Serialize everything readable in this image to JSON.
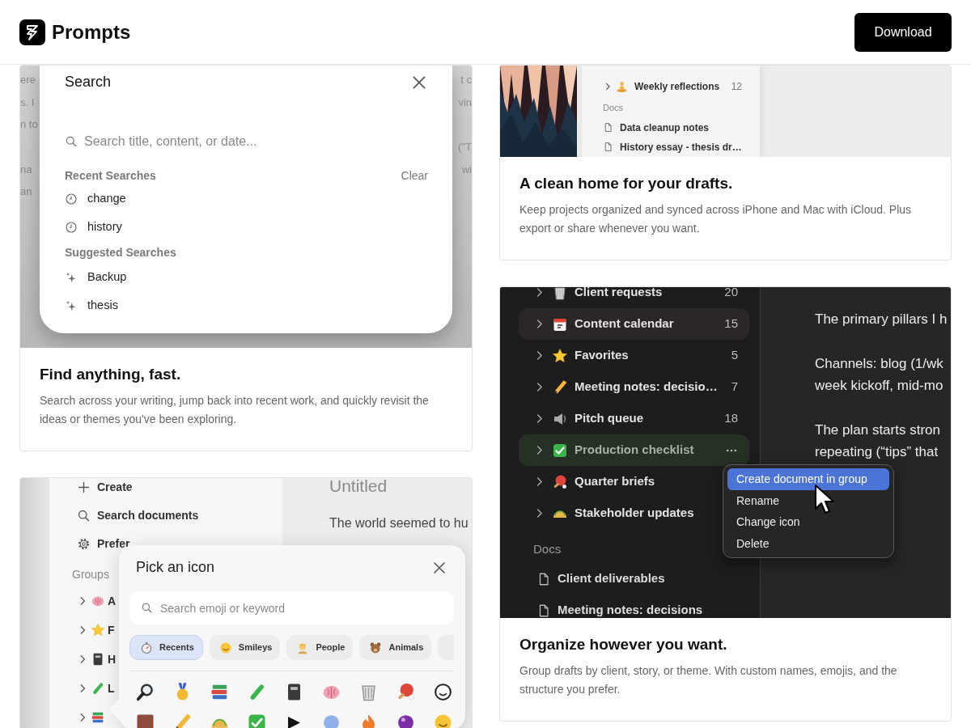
{
  "header": {
    "brand": "Prompts",
    "download_button": "Download"
  },
  "search_card": {
    "screenshot": {
      "backdrop_left": [
        [
          "ere",
          "s. I",
          "n to"
        ],
        [
          "na",
          "an"
        ]
      ],
      "backdrop_right": [
        [
          "t c",
          "vin"
        ],
        [
          "(\"T",
          "wi"
        ]
      ],
      "dialog": {
        "title": "Search",
        "placeholder": "Search title, content, or date...",
        "recent_heading": "Recent Searches",
        "clear_button": "Clear",
        "recent": [
          "change",
          "history"
        ],
        "suggested_heading": "Suggested Searches",
        "suggested": [
          "Backup",
          "thesis"
        ]
      }
    },
    "title": "Find anything, fast.",
    "description": "Search across your writing, jump back into recent work, and quickly revisit the ideas or themes you've been exploring."
  },
  "drafts_card": {
    "screenshot": {
      "groups": [
        {
          "name": "Weekly reflections",
          "count": "12",
          "expanded": false
        }
      ],
      "docs_heading": "Docs",
      "docs": [
        "Data cleanup notes",
        "History essay - thesis dr…"
      ]
    },
    "title": "A clean home for your drafts.",
    "description": "Keep projects organized and synced across iPhone and Mac with iCloud. Plus export or share whenever you want."
  },
  "icon_card": {
    "screenshot": {
      "actions": [
        "Create",
        "Search documents",
        "Prefer"
      ],
      "groups_heading": "Groups",
      "groups": [
        {
          "label": "A",
          "expanded": false
        },
        {
          "label": "F",
          "expanded": false
        },
        {
          "label": "H",
          "expanded": false
        },
        {
          "label": "L",
          "expanded": false
        },
        {
          "expanded": false
        }
      ],
      "document": {
        "title": "Untitled",
        "text": "The world seemed to hu"
      },
      "dialog": {
        "title": "Pick an icon",
        "placeholder": "Search emoji or keyword",
        "categories": [
          {
            "label": "Recents",
            "selected": true
          },
          {
            "label": "Smileys",
            "selected": false
          },
          {
            "label": "People",
            "selected": false
          },
          {
            "label": "Animals",
            "selected": false
          },
          {
            "selected": false
          }
        ]
      }
    }
  },
  "organize_card": {
    "screenshot": {
      "groups": [
        {
          "name": "Client requests",
          "count": "20",
          "expanded": false,
          "hovered": false,
          "selected": false
        },
        {
          "name": "Content calendar",
          "count": "15",
          "expanded": false,
          "hovered": true,
          "selected": false
        },
        {
          "name": "Favorites",
          "count": "5",
          "expanded": false,
          "hovered": false,
          "selected": false
        },
        {
          "name": "Meeting notes: decisio…",
          "count": "7",
          "expanded": false,
          "hovered": false,
          "selected": false
        },
        {
          "name": "Pitch queue",
          "count": "18",
          "expanded": false,
          "hovered": false,
          "selected": false
        },
        {
          "name": "Production checklist",
          "expanded": false,
          "hovered": false,
          "selected": true
        },
        {
          "name": "Quarter briefs",
          "expanded": false,
          "hovered": false,
          "selected": false
        },
        {
          "name": "Stakeholder updates",
          "expanded": false,
          "hovered": false,
          "selected": false
        }
      ],
      "docs_heading": "Docs",
      "docs": [
        "Client deliverables",
        "Meeting notes: decisions"
      ],
      "editor_paragraphs": [
        [
          "The primary pillars I h"
        ],
        [
          "Channels: blog (1/wk",
          "week kickoff, mid-mo"
        ],
        [
          "The plan starts stron",
          "repeating (“tips” that"
        ]
      ],
      "context_menu": [
        {
          "label": "Create document in group",
          "selected": true
        },
        {
          "label": "Rename",
          "selected": false
        },
        {
          "label": "Change icon",
          "selected": false
        },
        {
          "label": "Delete",
          "selected": false
        }
      ]
    },
    "title": "Organize however you want.",
    "description": "Group drafts by client, story, or theme. With custom names, emojis, and the structure you prefer."
  }
}
